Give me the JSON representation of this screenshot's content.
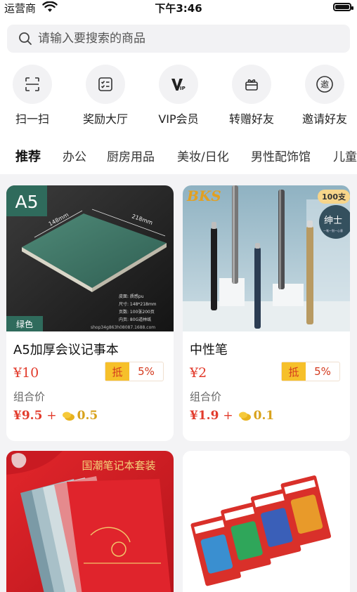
{
  "status": {
    "carrier": "运营商",
    "time": "下午3:46"
  },
  "search": {
    "placeholder": "请输入要搜索的商品"
  },
  "quick_actions": [
    {
      "label": "扫一扫",
      "icon": "scan-icon"
    },
    {
      "label": "奖励大厅",
      "icon": "checklist-icon"
    },
    {
      "label": "VIP会员",
      "icon": "vip-icon"
    },
    {
      "label": "转赠好友",
      "icon": "gift-icon"
    },
    {
      "label": "邀请好友",
      "icon": "invite-icon"
    }
  ],
  "tabs": [
    "推荐",
    "办公",
    "厨房用品",
    "美妆/日化",
    "男性配饰馆",
    "儿童"
  ],
  "products": [
    {
      "title": "A5加厚会议记事本",
      "price": "¥10",
      "coupon_tag": "抵",
      "coupon_pct": "5%",
      "combo_label": "组合价",
      "combo_price": "¥9.5",
      "combo_plus": "+",
      "combo_coin": "0.5",
      "badge_size": "A5",
      "badge_color": "绿色",
      "dim_top": "218mm",
      "dim_left": "148mm",
      "spec_lines": [
        "皮面: 质感pu",
        "尺寸: 148*218mm",
        "页数: 100张200页",
        "内页: 80G道林纸"
      ],
      "watermark": "shop34g863h08087.1688.com"
    },
    {
      "title": "中性笔",
      "price": "¥2",
      "coupon_tag": "抵",
      "coupon_pct": "5%",
      "combo_label": "组合价",
      "combo_price": "¥1.9",
      "combo_plus": "+",
      "combo_coin": "0.1",
      "brand": "BKS",
      "pack_badge": "100支",
      "seal_text": "绅士",
      "seal_sub": "一笔一划一心意"
    },
    {
      "banner_text": "国潮笔记本套装"
    },
    {}
  ],
  "colors": {
    "accent_red": "#e23b2c",
    "coupon_yellow": "#f6c02a",
    "coin_gold": "#d8a21c"
  }
}
